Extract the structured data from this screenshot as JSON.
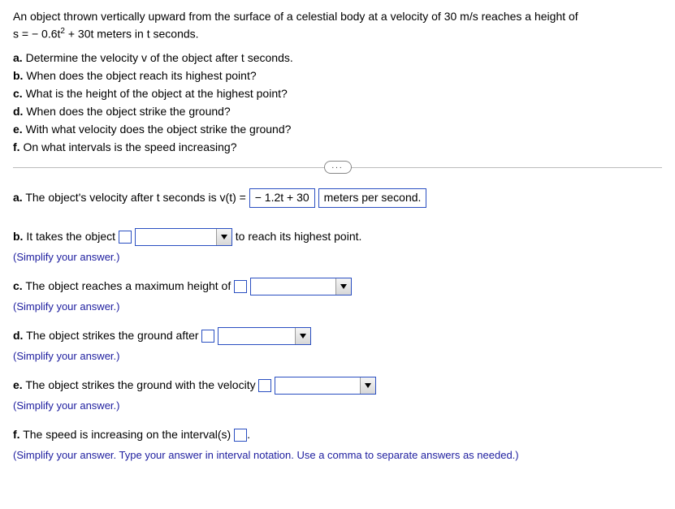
{
  "problem": {
    "intro_a": "An object thrown vertically upward from the surface of a celestial body at a velocity of 30 m/s reaches a height of",
    "eq_prefix": "s = ",
    "eq_minus": " − 0.6t",
    "eq_rest": " + 30t meters in t seconds.",
    "parts": {
      "a": "Determine the velocity v of the object after t seconds.",
      "b": "When does the object reach its highest point?",
      "c": "What is the height of the object at the highest point?",
      "d": "When does the object strike the ground?",
      "e": "With what velocity does the object strike the ground?",
      "f": "On what intervals is the speed increasing?"
    }
  },
  "labels": {
    "a": "a.",
    "b": "b.",
    "c": "c.",
    "d": "d.",
    "e": "e.",
    "f": "f."
  },
  "answers": {
    "a": {
      "pre": "The object's velocity after t seconds is v(t) =",
      "val": " − 1.2t + 30",
      "unit": "meters per second."
    },
    "b": {
      "pre": "It takes the object",
      "post": "to reach its highest point."
    },
    "c": {
      "pre": "The object reaches a maximum height of"
    },
    "d": {
      "pre": "The object strikes the ground after"
    },
    "e": {
      "pre": "The object strikes the ground with the velocity"
    },
    "f": {
      "pre": "The speed is increasing on the interval(s)",
      "post": "."
    }
  },
  "hints": {
    "simplify": "(Simplify your answer.)",
    "interval": "(Simplify your answer. Type your answer in interval notation. Use a comma to separate answers as needed.)"
  },
  "ellipsis": "..."
}
